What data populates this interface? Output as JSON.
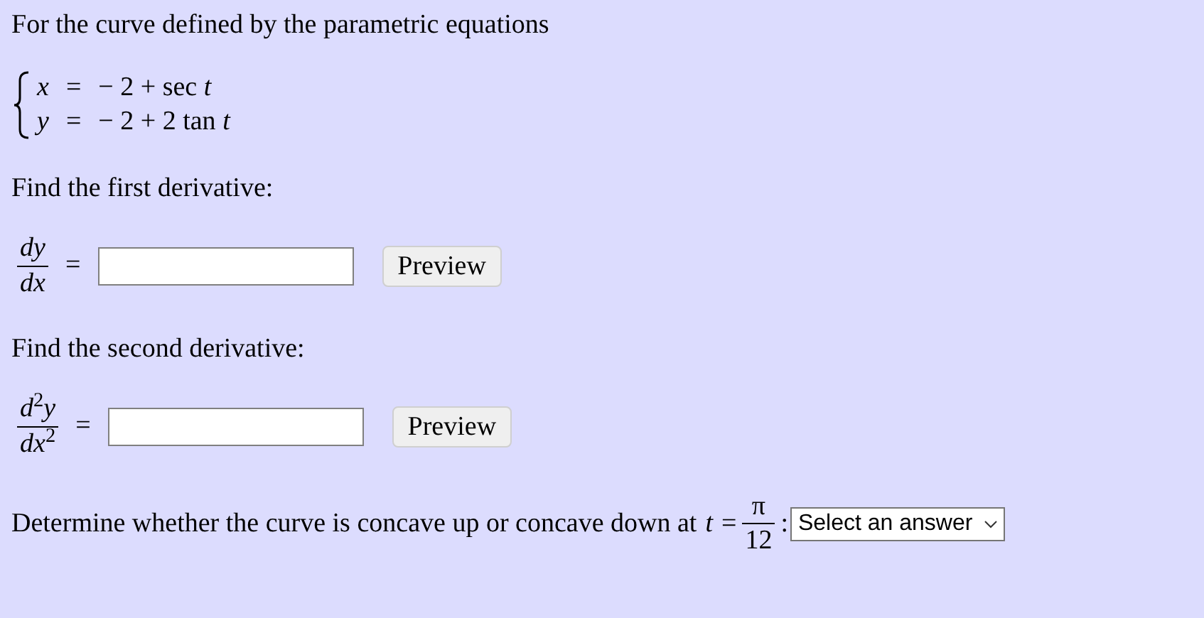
{
  "intro": "For the curve defined by the parametric equations",
  "equations": [
    {
      "variable": "x",
      "sign": "=",
      "expression": "− 2 + sec *t*"
    },
    {
      "variable": "y",
      "sign": "=",
      "expression": "− 2 + 2 tan *t*"
    }
  ],
  "parts": [
    {
      "prompt": "Find the first derivative:",
      "numerator": "*dy*",
      "denominator": "*dx*",
      "sign": "=",
      "button": "Preview"
    },
    {
      "prompt": "Find the second derivative:",
      "numerator": "*d*$^{2}$*y*",
      "denominator": "*dx*$^{2}$",
      "sign": "=",
      "button": "Preview"
    }
  ],
  "question": {
    "text": "Determine whether the curve is concave up or concave down at",
    "variable": "t",
    "sign": "=",
    "numerator": "π",
    "denominator": "12",
    "colon": ":",
    "select": "Select an answer"
  }
}
